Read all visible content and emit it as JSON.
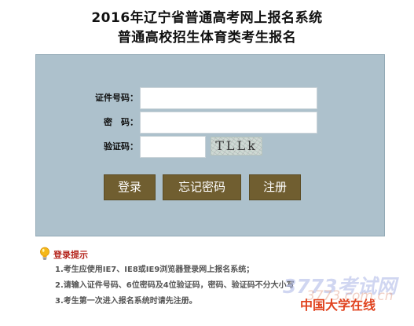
{
  "header": {
    "title_line1": "2016年辽宁省普通高考网上报名系统",
    "title_line2": "普通高校招生体育类考生报名"
  },
  "login": {
    "id_label": "证件号码：",
    "password_label": "密　码：",
    "captcha_label": "验证码：",
    "id_value": "",
    "password_value": "",
    "captcha_value": "",
    "captcha_image_text": "TLLk",
    "login_button": "登录",
    "forgot_button": "忘记密码",
    "register_button": "注册"
  },
  "tips": {
    "title": "登录提示",
    "items": [
      "1.考生应使用IE7、IE8或IE9浏览器登录网上报名系统；",
      "2.请输入证件号码、6位密码及4位验证码，密码、验证码不分大小写",
      "3.考生第一次进入报名系统时请先注册。"
    ]
  },
  "watermark": {
    "line1": "3773考试网",
    "line2": "3773.com.cn",
    "line3": "中国大学在线"
  },
  "colors": {
    "panel_bg": "#adc1cc",
    "button_bg": "#705e30",
    "tip_title": "#b5261e",
    "watermark_red": "#e0421e"
  }
}
